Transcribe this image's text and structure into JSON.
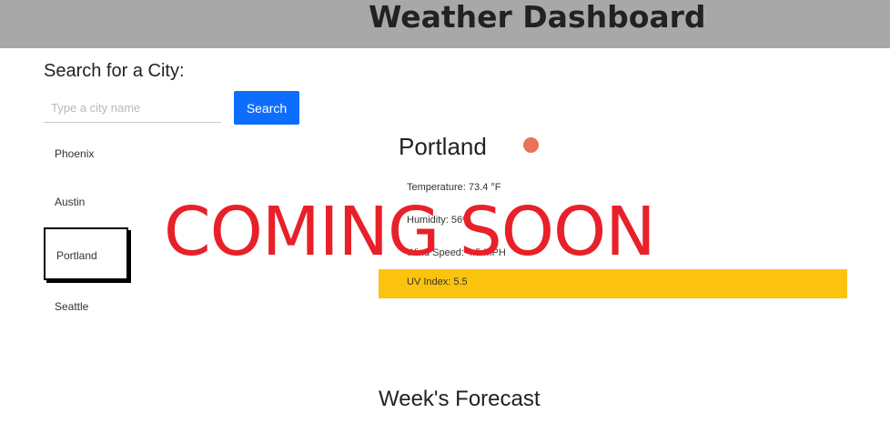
{
  "header": {
    "title": "Weather Dashboard"
  },
  "search": {
    "label": "Search for a City:",
    "placeholder": "Type a city name",
    "button_label": "Search"
  },
  "cities": [
    {
      "name": "Phoenix",
      "active": false
    },
    {
      "name": "Austin",
      "active": false
    },
    {
      "name": "Portland",
      "active": true
    },
    {
      "name": "Seattle",
      "active": false
    }
  ],
  "current": {
    "city": "Portland",
    "icon": "weather-icon",
    "details": [
      "Temperature: 73.4 °F",
      "Humidity: 56%",
      "Wind Speed: 4.5 MPH"
    ],
    "uv": {
      "label": "UV Index: 5.5",
      "color": "#fbc30d"
    }
  },
  "forecast": {
    "title": "Week's Forecast"
  },
  "overlay": {
    "text": "COMING SOON",
    "color": "#e8202a"
  },
  "colors": {
    "header_bg": "#a8a8a8",
    "accent": "#0d6efd"
  }
}
